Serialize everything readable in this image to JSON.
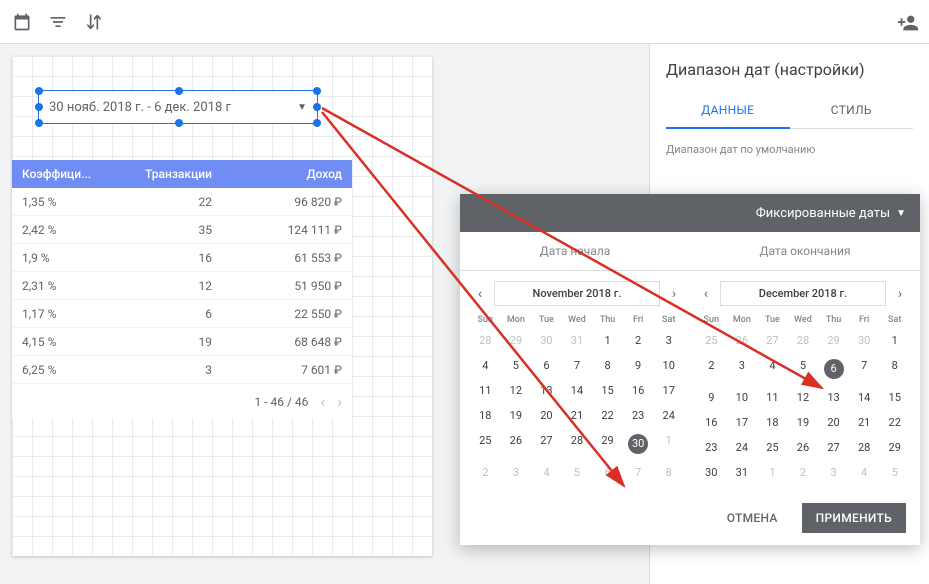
{
  "date_widget": {
    "text": "30 нояб. 2018 г. - 6 дек. 2018 г"
  },
  "table": {
    "headers": [
      "Коэффици...",
      "Транзакции",
      "Доход"
    ],
    "rows": [
      {
        "c1": "1,35 %",
        "c2": "22",
        "c3": "96 820 ₽"
      },
      {
        "c1": "2,42 %",
        "c2": "35",
        "c3": "124 111 ₽"
      },
      {
        "c1": "1,9 %",
        "c2": "16",
        "c3": "61 553 ₽"
      },
      {
        "c1": "2,31 %",
        "c2": "12",
        "c3": "51 950 ₽"
      },
      {
        "c1": "1,17 %",
        "c2": "6",
        "c3": "22 550 ₽"
      },
      {
        "c1": "4,15 %",
        "c2": "19",
        "c3": "68 648 ₽"
      },
      {
        "c1": "6,25 %",
        "c2": "3",
        "c3": "7 601 ₽"
      }
    ],
    "footer": "1 - 46 / 46"
  },
  "side_panel": {
    "title": "Диапазон дат (настройки)",
    "tab_data": "ДАННЫЕ",
    "tab_style": "СТИЛЬ",
    "field_label": "Диапазон дат по умолчанию"
  },
  "popup": {
    "fixed_dates": "Фиксированные даты",
    "tab_start": "Дата начала",
    "tab_end": "Дата окончания",
    "month1": "November 2018 г.",
    "month2": "December 2018 г.",
    "dow": [
      "Sun",
      "Mon",
      "Tue",
      "Wed",
      "Thu",
      "Fri",
      "Sat"
    ],
    "cal1": [
      {
        "d": "28",
        "m": 1
      },
      {
        "d": "29",
        "m": 1
      },
      {
        "d": "30",
        "m": 1
      },
      {
        "d": "31",
        "m": 1
      },
      {
        "d": "1"
      },
      {
        "d": "2"
      },
      {
        "d": "3"
      },
      {
        "d": "4"
      },
      {
        "d": "5"
      },
      {
        "d": "6"
      },
      {
        "d": "7"
      },
      {
        "d": "8"
      },
      {
        "d": "9"
      },
      {
        "d": "10"
      },
      {
        "d": "11"
      },
      {
        "d": "12"
      },
      {
        "d": "13"
      },
      {
        "d": "14"
      },
      {
        "d": "15"
      },
      {
        "d": "16"
      },
      {
        "d": "17"
      },
      {
        "d": "18"
      },
      {
        "d": "19"
      },
      {
        "d": "20"
      },
      {
        "d": "21"
      },
      {
        "d": "22"
      },
      {
        "d": "23"
      },
      {
        "d": "24"
      },
      {
        "d": "25"
      },
      {
        "d": "26"
      },
      {
        "d": "27"
      },
      {
        "d": "28"
      },
      {
        "d": "29"
      },
      {
        "d": "30",
        "s": 1
      },
      {
        "d": "1",
        "m": 1
      },
      {
        "d": "2",
        "m": 1
      },
      {
        "d": "3",
        "m": 1
      },
      {
        "d": "4",
        "m": 1
      },
      {
        "d": "5",
        "m": 1
      },
      {
        "d": "6",
        "m": 1
      },
      {
        "d": "7",
        "m": 1
      },
      {
        "d": "8",
        "m": 1
      }
    ],
    "cal2": [
      {
        "d": "25",
        "m": 1
      },
      {
        "d": "26",
        "m": 1
      },
      {
        "d": "27",
        "m": 1
      },
      {
        "d": "28",
        "m": 1
      },
      {
        "d": "29",
        "m": 1
      },
      {
        "d": "30",
        "m": 1
      },
      {
        "d": "1"
      },
      {
        "d": "2"
      },
      {
        "d": "3"
      },
      {
        "d": "4"
      },
      {
        "d": "5"
      },
      {
        "d": "6",
        "s": 1
      },
      {
        "d": "7"
      },
      {
        "d": "8"
      },
      {
        "d": "9"
      },
      {
        "d": "10"
      },
      {
        "d": "11"
      },
      {
        "d": "12"
      },
      {
        "d": "13"
      },
      {
        "d": "14"
      },
      {
        "d": "15"
      },
      {
        "d": "16"
      },
      {
        "d": "17"
      },
      {
        "d": "18"
      },
      {
        "d": "19"
      },
      {
        "d": "20"
      },
      {
        "d": "21"
      },
      {
        "d": "22"
      },
      {
        "d": "23"
      },
      {
        "d": "24"
      },
      {
        "d": "25"
      },
      {
        "d": "26"
      },
      {
        "d": "27"
      },
      {
        "d": "28"
      },
      {
        "d": "29"
      },
      {
        "d": "30"
      },
      {
        "d": "31"
      },
      {
        "d": "1",
        "m": 1
      },
      {
        "d": "2",
        "m": 1
      },
      {
        "d": "3",
        "m": 1
      },
      {
        "d": "4",
        "m": 1
      },
      {
        "d": "5",
        "m": 1
      }
    ],
    "cancel": "ОТМЕНА",
    "apply": "ПРИМЕНИТЬ"
  }
}
